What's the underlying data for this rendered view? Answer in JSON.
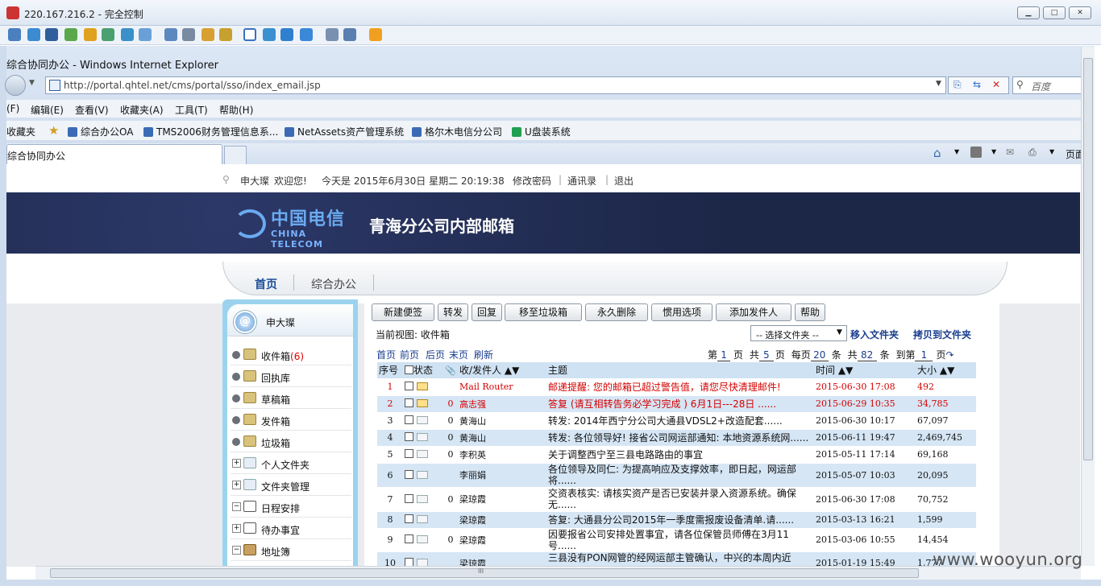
{
  "remote": {
    "title": "220.167.216.2 - 完全控制",
    "buttons": [
      "min",
      "max",
      "close"
    ]
  },
  "ie": {
    "window_title": "综合协同办公 - Windows Internet Explorer",
    "address": "http://portal.qhtel.net/cms/portal/sso/index_email.jsp",
    "search_placeholder": "百度",
    "menu": [
      "(F)",
      "编辑(E)",
      "查看(V)",
      "收藏夹(A)",
      "工具(T)",
      "帮助(H)"
    ],
    "favorites_label": "收藏夹",
    "favorites": [
      "综合办公OA",
      "TMS2006财务管理信息系...",
      "NetAssets资产管理系统",
      "格尔木电信分公司",
      "U盘装系统"
    ],
    "tab": "综合协同办公",
    "page_menu": "页面"
  },
  "top": {
    "user": "申大璨",
    "welcome": "欢迎您!",
    "date": "今天是 2015年6月30日 星期二 20:19:38",
    "links": [
      "修改密码",
      "通讯录",
      "退出"
    ],
    "sep": "|"
  },
  "banner": {
    "logo_cn": "中国电信",
    "logo_en": "CHINA TELECOM",
    "title": "青海分公司内部邮箱"
  },
  "nav": {
    "home": "首页",
    "oa": "综合办公"
  },
  "sidebar": {
    "user": "申大璨",
    "items": [
      {
        "label": "收件箱",
        "count": "(6)"
      },
      {
        "label": "回执库"
      },
      {
        "label": "草稿箱"
      },
      {
        "label": "发件箱"
      },
      {
        "label": "垃圾箱"
      },
      {
        "label": "个人文件夹"
      },
      {
        "label": "文件夹管理"
      },
      {
        "label": "日程安排"
      },
      {
        "label": "待办事宜"
      },
      {
        "label": "地址簿"
      }
    ]
  },
  "toolbar": [
    "新建便签",
    "转发",
    "回复",
    "移至垃圾箱",
    "永久删除",
    "惯用选项",
    "添加发件人",
    "帮助"
  ],
  "view": {
    "current": "当前视图: 收件箱",
    "folder_select": "-- 选择文件夹 --",
    "move_to": "移入文件夹",
    "copy_to": "拷贝到文件夹"
  },
  "pager": {
    "links": [
      "首页",
      "前页",
      "后页",
      "末页",
      "刷新"
    ],
    "page": "1",
    "total_pages": "5",
    "per_page": "20",
    "total": "82",
    "goto": "1",
    "t_di": "第",
    "t_ye": "页",
    "t_gong": "共",
    "t_meiye": "每页",
    "t_tiao": "条",
    "t_dao": "到第"
  },
  "table": {
    "headers": [
      "序号",
      "状态",
      "收/发件人",
      "主题",
      "时间",
      "大小"
    ],
    "rows": [
      {
        "no": "1",
        "from": "Mail Router",
        "subject": "邮递提醒: 您的邮箱已超过警告值，请您尽快清理邮件!",
        "time": "2015-06-30 17:08",
        "size": "492"
      },
      {
        "no": "2",
        "from": "高志强",
        "subject": "答复 (请互相转告务必学习完成 ) 6月1日---28日 ......",
        "time": "2015-06-29 10:35",
        "size": "34,785"
      },
      {
        "no": "3",
        "from": "黄海山",
        "subject": "转发: 2014年西宁分公司大通县VDSL2+改造配套......",
        "time": "2015-06-30 10:17",
        "size": "67,097"
      },
      {
        "no": "4",
        "from": "黄海山",
        "subject": "转发: 各位领导好! 接省公司网运部通知: 本地资源系统网......",
        "time": "2015-06-11 19:47",
        "size": "2,469,745"
      },
      {
        "no": "5",
        "from": "李积英",
        "subject": "关于调整西宁至三县电路路由的事宜",
        "time": "2015-05-11 17:14",
        "size": "69,168"
      },
      {
        "no": "6",
        "from": "李丽娟",
        "subject": "各位领导及同仁: 为提高响应及支撑效率，即日起，网运部将......",
        "time": "2015-05-07 10:03",
        "size": "20,095"
      },
      {
        "no": "7",
        "from": "梁琼霞",
        "subject": "交资表核实: 请核实资产是否已安装并录入资源系统。确保无......",
        "time": "2015-06-30 17:08",
        "size": "70,752"
      },
      {
        "no": "8",
        "from": "梁琼霞",
        "subject": "答复: 大通县分公司2015年一季度需报废设备清单.请......",
        "time": "2015-03-13 16:21",
        "size": "1,599"
      },
      {
        "no": "9",
        "from": "梁琼霞",
        "subject": "因要报省公司安排处置事宜，请各位保管员师傅在3月11号......",
        "time": "2015-03-06 10:55",
        "size": "14,454"
      },
      {
        "no": "10",
        "from": "梁琼霞",
        "subject": "三县没有PON网管的经网运部主管确认，中兴的本周内近一......",
        "time": "2015-01-19 15:49",
        "size": "1,777"
      }
    ]
  },
  "scroll_label": "III",
  "watermark": "www.wooyun.org"
}
